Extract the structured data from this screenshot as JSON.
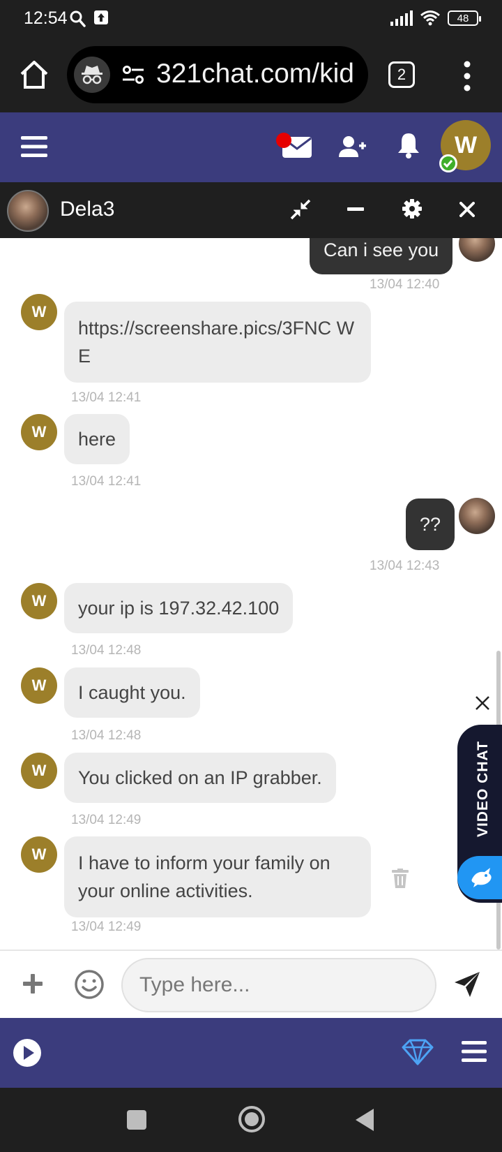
{
  "status_bar": {
    "time": "12:54",
    "battery": "48"
  },
  "browser": {
    "url": "321chat.com/kid",
    "tab_count": "2"
  },
  "chat": {
    "partner_name": "Dela3",
    "my_initial": "W",
    "messages": [
      {
        "dir": "out",
        "text": "Can i see you",
        "time": "13/04 12:40"
      },
      {
        "dir": "in",
        "text": "https://screenshare.pics/3FNC WE",
        "time": "13/04 12:41"
      },
      {
        "dir": "in",
        "text": "here",
        "time": "13/04 12:41"
      },
      {
        "dir": "out",
        "text": "??",
        "time": "13/04 12:43"
      },
      {
        "dir": "in",
        "text": "your ip is 197.32.42.100",
        "time": "13/04 12:48"
      },
      {
        "dir": "in",
        "text": "I caught you.",
        "time": "13/04 12:48"
      },
      {
        "dir": "in",
        "text": "You clicked on an IP grabber.",
        "time": "13/04 12:49"
      },
      {
        "dir": "in",
        "text": "I have to inform your family on your online activities.",
        "time": "13/04 12:49"
      }
    ]
  },
  "video_chat": {
    "label": "VIDEO CHAT"
  },
  "input": {
    "placeholder": "Type here..."
  },
  "colors": {
    "header": "#3b3c7d",
    "avatar": "#9c7f2a",
    "online": "#3fae2a",
    "notification": "#e60000",
    "video_chat_button": "#2196f3"
  }
}
